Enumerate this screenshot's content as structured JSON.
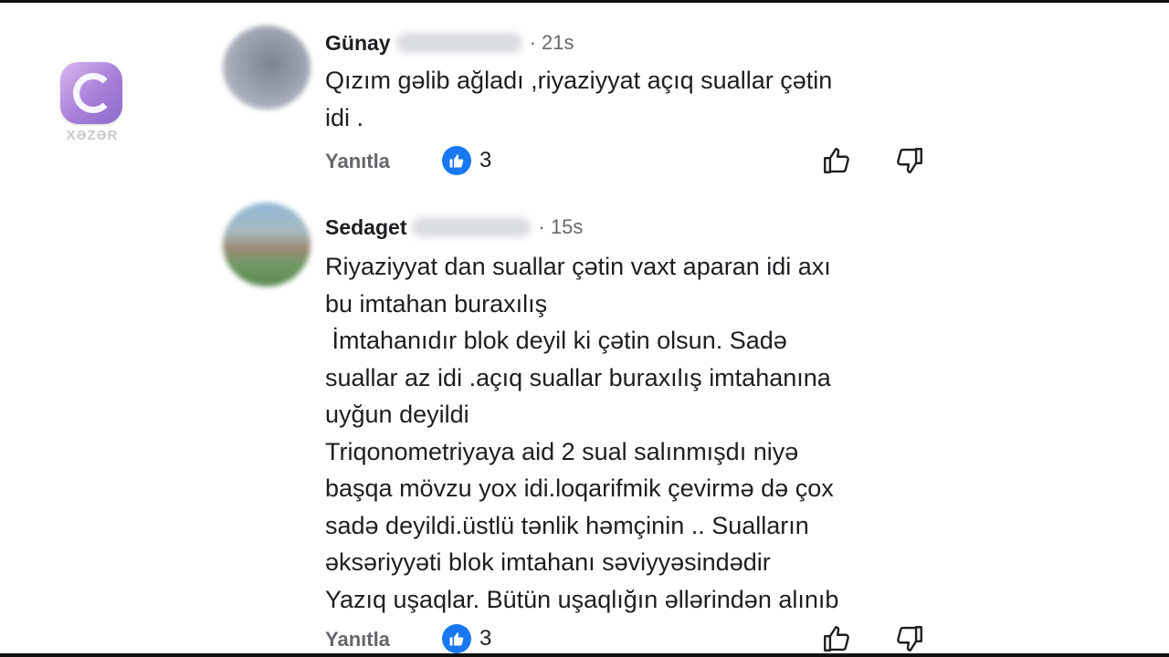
{
  "channel": {
    "logo_text": "XƏZƏR"
  },
  "comments": [
    {
      "author": "Günay",
      "time": "21s",
      "lines": [
        "Qızım gəlib ağladı ,riyaziyyat açıq suallar çətin",
        "idi ."
      ],
      "reply_label": "Yanıtla",
      "like_count": "3"
    },
    {
      "author": "Sedaget",
      "time": "15s",
      "lines": [
        "Riyaziyyat dan suallar çətin vaxt aparan idi axı",
        "bu imtahan buraxılış",
        " İmtahanıdır blok deyil ki çətin olsun. Sadə",
        "suallar az idi .açıq suallar buraxılış imtahanına",
        "uyğun deyildi",
        "Triqonometriyaya aid 2 sual salınmışdı niyə",
        "başqa mövzu yox idi.loqarifmik çevirmə də çox",
        "sadə deyildi.üstlü tənlik həmçinin .. Sualların",
        "əksəriyyəti blok imtahanı səviyyəsindədir",
        "Yazıq uşaqlar. Bütün uşaqlığın əllərindən alınıb"
      ],
      "reply_label": "Yanıtla",
      "like_count": "3"
    }
  ],
  "colors": {
    "like_badge": "#1877f2",
    "meta_text": "#65676b",
    "body_text": "#1c1e21"
  }
}
